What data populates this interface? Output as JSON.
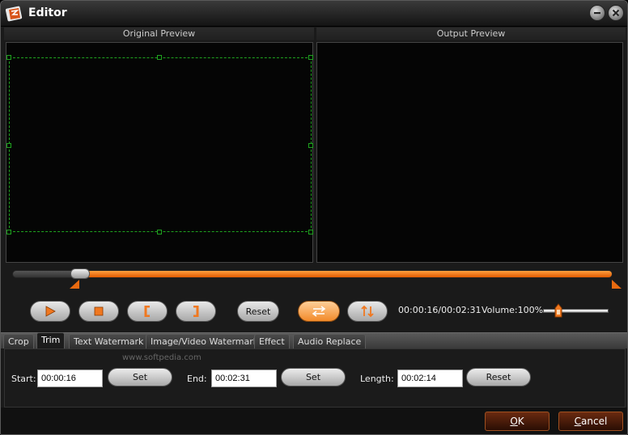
{
  "window": {
    "title": "Editor"
  },
  "preview": {
    "original_label": "Original Preview",
    "output_label": "Output Preview"
  },
  "timeline": {
    "position_fraction": 0.11
  },
  "controls": {
    "reset_label": "Reset",
    "time": "00:00:16/00:02:31",
    "volume": "Volume:100%",
    "volume_level": 0.2
  },
  "tabs": [
    {
      "label": "Crop",
      "active": false
    },
    {
      "label": "Trim",
      "active": true
    },
    {
      "label": "Text Watermark",
      "active": false
    },
    {
      "label": "Image/Video Watermark",
      "active": false
    },
    {
      "label": "Effect",
      "active": false
    },
    {
      "label": "Audio Replace",
      "active": false
    }
  ],
  "trim": {
    "watermark_text": "www.softpedia.com",
    "start_label": "Start:",
    "start_value": "00:00:16",
    "end_label": "End:",
    "end_value": "00:02:31",
    "length_label": "Length:",
    "length_value": "00:02:14",
    "set_label": "Set",
    "reset_label": "Reset"
  },
  "dialog": {
    "ok_label": "OK",
    "ok_mnemonic": "O",
    "ok_rest": "K",
    "cancel_label": "Cancel",
    "cancel_mnemonic": "C",
    "cancel_rest": "ancel"
  },
  "colors": {
    "accent": "#f07820",
    "crop_guide": "#1fa31f"
  }
}
